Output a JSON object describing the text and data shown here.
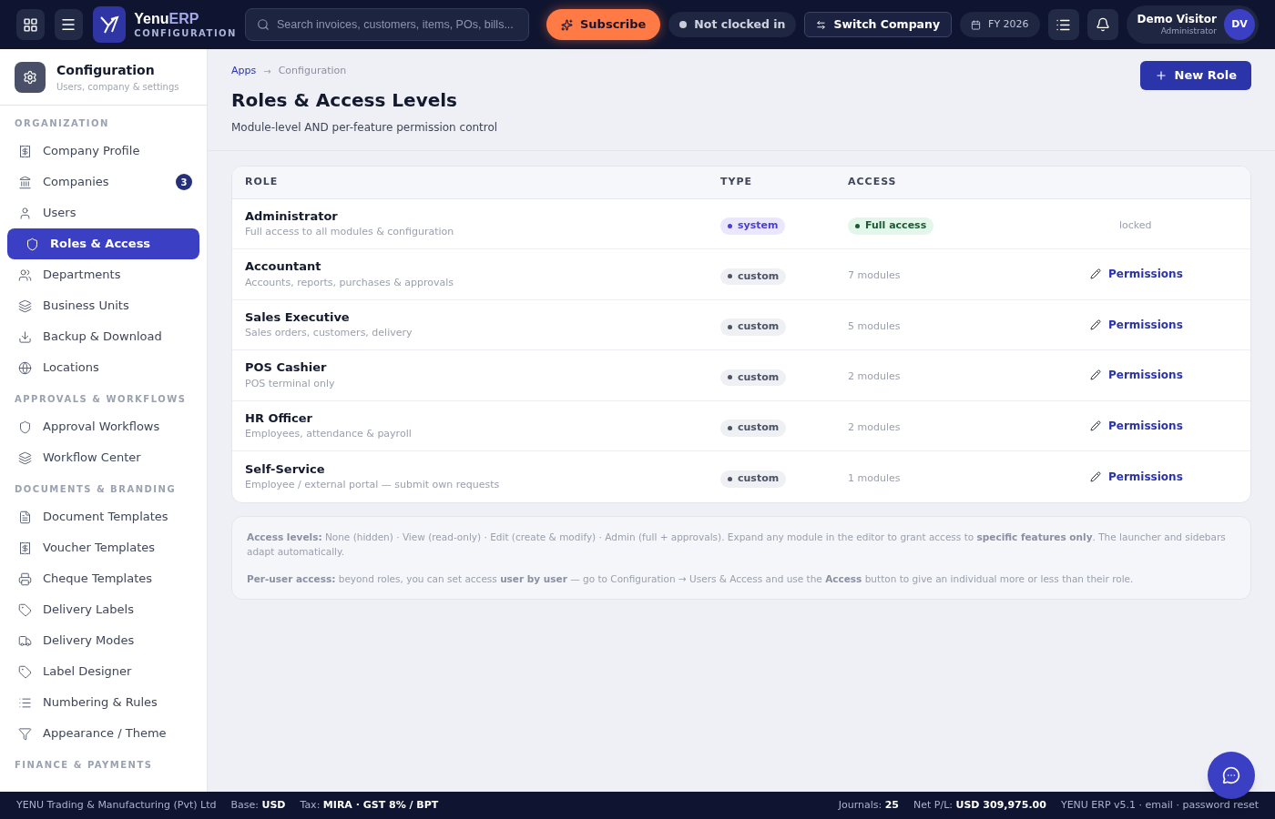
{
  "topbar": {
    "brand_main": "Yenu",
    "brand_accent": "ERP",
    "brand_sub": "CONFIGURATION",
    "search": {
      "placeholder": "Search invoices, customers, items, POs, bills..."
    },
    "subscribe": "Subscribe",
    "clock": "Not clocked in",
    "switch_company": "Switch Company",
    "fiscal_year": "FY 2026",
    "user": {
      "name": "Demo Visitor",
      "role": "Administrator",
      "initials": "DV"
    }
  },
  "sidebar": {
    "title": "Configuration",
    "subtitle": "Users, company & settings",
    "sections": [
      {
        "heading": "ORGANIZATION",
        "items": [
          {
            "label": "Company Profile",
            "selected": false
          },
          {
            "label": "Companies",
            "selected": false,
            "badge": "3"
          },
          {
            "label": "Users",
            "selected": false
          },
          {
            "label": "Roles & Access",
            "selected": true
          },
          {
            "label": "Departments",
            "selected": false
          },
          {
            "label": "Business Units",
            "selected": false
          },
          {
            "label": "Backup & Download",
            "selected": false
          },
          {
            "label": "Locations",
            "selected": false
          }
        ]
      },
      {
        "heading": "APPROVALS & WORKFLOWS",
        "items": [
          {
            "label": "Approval Workflows",
            "selected": false
          },
          {
            "label": "Workflow Center",
            "selected": false
          }
        ]
      },
      {
        "heading": "DOCUMENTS & BRANDING",
        "items": [
          {
            "label": "Document Templates",
            "selected": false
          },
          {
            "label": "Voucher Templates",
            "selected": false
          },
          {
            "label": "Cheque Templates",
            "selected": false
          },
          {
            "label": "Delivery Labels",
            "selected": false
          },
          {
            "label": "Delivery Modes",
            "selected": false
          },
          {
            "label": "Label Designer",
            "selected": false
          },
          {
            "label": "Numbering & Rules",
            "selected": false
          },
          {
            "label": "Appearance / Theme",
            "selected": false
          }
        ]
      },
      {
        "heading": "FINANCE & PAYMENTS"
      }
    ]
  },
  "breadcrumb": {
    "items": [
      "Apps",
      "Configuration"
    ],
    "separator": "→"
  },
  "page": {
    "title": "Roles & Access Levels",
    "subtitle": "Module-level AND per-feature permission control",
    "new_button": "New Role"
  },
  "table": {
    "columns": [
      "ROLE",
      "TYPE",
      "ACCESS"
    ],
    "rows": [
      {
        "name": "Administrator",
        "description": "Full access to all modules & configuration",
        "type": {
          "label": "system",
          "kind": "system"
        },
        "access": {
          "label": "Full access",
          "kind": "full"
        },
        "action": {
          "label": "locked",
          "kind": "locked"
        }
      },
      {
        "name": "Accountant",
        "description": "Accounts, reports, purchases & approvals",
        "type": {
          "label": "custom",
          "kind": "custom"
        },
        "access": {
          "label": "7 modules",
          "kind": "modules"
        },
        "action": {
          "label": "Permissions",
          "kind": "link"
        }
      },
      {
        "name": "Sales Executive",
        "description": "Sales orders, customers, delivery",
        "type": {
          "label": "custom",
          "kind": "custom"
        },
        "access": {
          "label": "5 modules",
          "kind": "modules"
        },
        "action": {
          "label": "Permissions",
          "kind": "link"
        }
      },
      {
        "name": "POS Cashier",
        "description": "POS terminal only",
        "type": {
          "label": "custom",
          "kind": "custom"
        },
        "access": {
          "label": "2 modules",
          "kind": "modules"
        },
        "action": {
          "label": "Permissions",
          "kind": "link"
        }
      },
      {
        "name": "HR Officer",
        "description": "Employees, attendance & payroll",
        "type": {
          "label": "custom",
          "kind": "custom"
        },
        "access": {
          "label": "2 modules",
          "kind": "modules"
        },
        "action": {
          "label": "Permissions",
          "kind": "link"
        }
      },
      {
        "name": "Self-Service",
        "description": "Employee / external portal — submit own requests",
        "type": {
          "label": "custom",
          "kind": "custom"
        },
        "access": {
          "label": "1 modules",
          "kind": "modules"
        },
        "action": {
          "label": "Permissions",
          "kind": "link"
        }
      }
    ]
  },
  "notes": [
    "**Access levels:** None (hidden) · View (read-only) · Edit (create & modify) · Admin (full + approvals). Expand any module in the editor to grant access to **specific features only**. The launcher and sidebars adapt automatically.",
    "**Per-user access:** beyond roles, you can set access **user by user** — go to Configuration → Users & Access and use the **Access** button to give an individual more or less than their role."
  ],
  "status_bar": {
    "company": "YENU Trading & Manufacturing (Pvt) Ltd",
    "left": [
      {
        "label": "Base:",
        "value": "USD"
      },
      {
        "label": "Tax:",
        "value": "MIRA · GST 8% / BPT"
      }
    ],
    "right": [
      {
        "label": "Journals:",
        "value": "25"
      },
      {
        "label": "Net P/L:",
        "value": "USD 309,975.00"
      }
    ],
    "version": "YENU ERP v5.1 · email · password reset"
  }
}
